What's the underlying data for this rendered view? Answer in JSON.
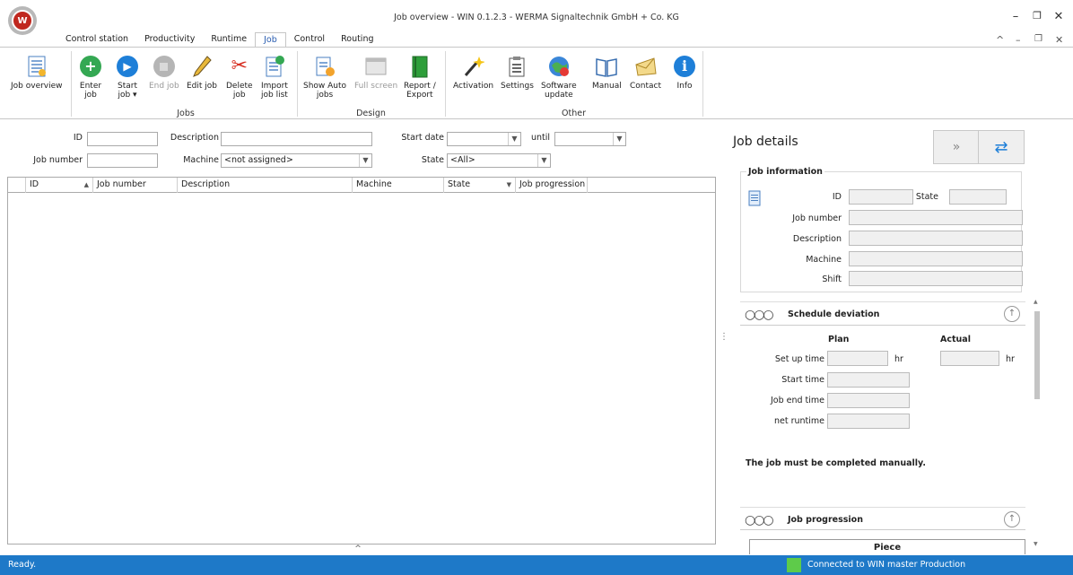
{
  "window": {
    "title": "Job overview - WIN 0.1.2.3 - WERMA Signaltechnik GmbH + Co. KG",
    "logo_text": "W",
    "controls": {
      "minimize": "–",
      "restore": "❐",
      "close": "✕"
    },
    "ribbon_controls": {
      "collapse": "^",
      "minimize": "–",
      "restore": "❐",
      "close": "✕"
    }
  },
  "tabs": [
    "Control station",
    "Productivity",
    "Runtime",
    "Job",
    "Control",
    "Routing"
  ],
  "active_tab": "Job",
  "ribbon": {
    "job_overview": "Job overview",
    "enter_job": [
      "Enter",
      "job"
    ],
    "start_job": [
      "Start",
      "job ▾"
    ],
    "end_job": "End job",
    "edit_job": "Edit job",
    "delete_job": [
      "Delete",
      "job"
    ],
    "import_job_list": [
      "Import",
      "job list"
    ],
    "show_auto_jobs": [
      "Show Auto",
      "jobs"
    ],
    "full_screen": "Full screen",
    "report_export": [
      "Report /",
      "Export"
    ],
    "activation": "Activation",
    "settings": "Settings",
    "software_update": [
      "Software",
      "update"
    ],
    "manual": "Manual",
    "contact": "Contact",
    "info": "Info",
    "groups": {
      "jobs": "Jobs",
      "design": "Design",
      "other": "Other"
    }
  },
  "filter": {
    "id_label": "ID",
    "description_label": "Description",
    "start_date_label": "Start date",
    "until_label": "until",
    "job_number_label": "Job number",
    "machine_label": "Machine",
    "machine_value": "<not assigned>",
    "state_label": "State",
    "state_value": "<All>"
  },
  "grid": {
    "columns": [
      "ID",
      "Job number",
      "Description",
      "Machine",
      "State",
      "Job progression"
    ]
  },
  "details": {
    "title": "Job details",
    "job_information": "Job information",
    "id_label": "ID",
    "state_label": "State",
    "job_number_label": "Job number",
    "description_label": "Description",
    "machine_label": "Machine",
    "shift_label": "Shift",
    "schedule_deviation": "Schedule deviation",
    "plan": "Plan",
    "actual": "Actual",
    "set_up_time": "Set up time",
    "hr": "hr",
    "start_time": "Start time",
    "job_end_time": "Job end time",
    "net_runtime": "net runtime",
    "manual_note": "The job must be completed manually.",
    "job_progression": "Job progression",
    "piece": "Piece"
  },
  "status": {
    "left": "Ready.",
    "right": "Connected to WIN master Production",
    "indicator_color": "#5ecb4a"
  }
}
